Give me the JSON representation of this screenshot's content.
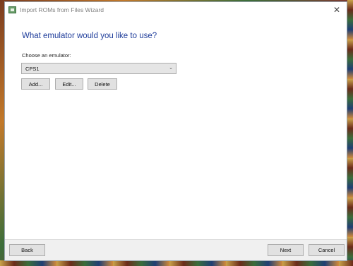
{
  "window": {
    "title": "Import ROMs from Files Wizard"
  },
  "page": {
    "heading": "What emulator would you like to use?",
    "choose_label": "Choose an emulator:",
    "emulator_selected": "CPS1"
  },
  "buttons": {
    "add": "Add...",
    "edit": "Edit...",
    "delete": "Delete",
    "back": "Back",
    "next": "Next",
    "cancel": "Cancel"
  },
  "icons": {
    "close": "✕",
    "dropdown": "⌄"
  }
}
